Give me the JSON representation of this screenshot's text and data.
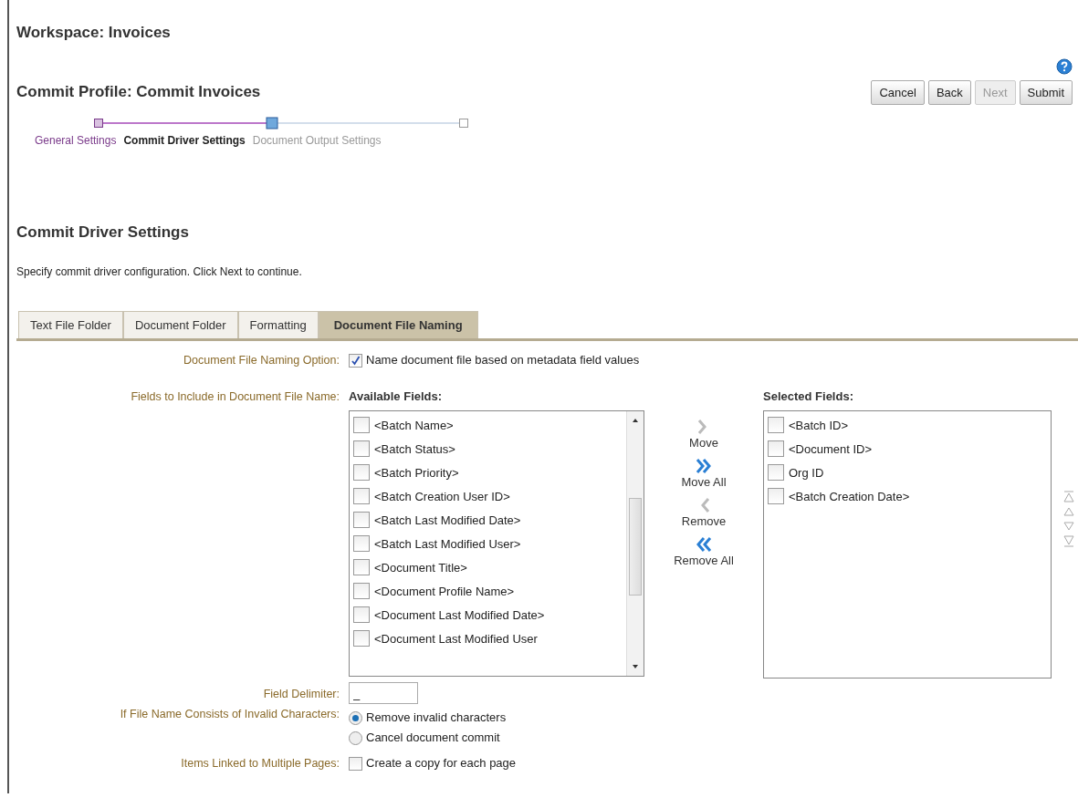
{
  "workspace_title": "Workspace: Invoices",
  "profile_title": "Commit Profile: Commit Invoices",
  "buttons": [
    {
      "label": "Cancel",
      "disabled": false
    },
    {
      "label": "Back",
      "disabled": false
    },
    {
      "label": "Next",
      "disabled": true
    },
    {
      "label": "Submit",
      "disabled": false
    }
  ],
  "train": [
    {
      "label": "General Settings",
      "visited": true,
      "selected": false
    },
    {
      "label": "Commit Driver Settings",
      "visited": true,
      "selected": true
    },
    {
      "label": "Document Output Settings",
      "visited": false,
      "selected": false
    }
  ],
  "section_title": "Commit Driver Settings",
  "description": "Specify commit driver configuration. Click Next to continue.",
  "tabs": [
    {
      "label": "Text File Folder",
      "selected": false
    },
    {
      "label": "Document Folder",
      "selected": false
    },
    {
      "label": "Formatting",
      "selected": false
    },
    {
      "label": "Document File Naming",
      "selected": true
    }
  ],
  "naming_option": {
    "label": "Document File Naming Option:",
    "text": "Name document file based on metadata field values",
    "checked": true
  },
  "fields_label": "Fields to Include in Document File Name:",
  "available": {
    "title": "Available Fields:",
    "items": [
      {
        "text": "<Batch Name>",
        "checked": false
      },
      {
        "text": "<Batch Status>",
        "checked": false
      },
      {
        "text": "<Batch Priority>",
        "checked": false
      },
      {
        "text": "<Batch Creation User ID>",
        "checked": false
      },
      {
        "text": "<Batch Last Modified Date>",
        "checked": false
      },
      {
        "text": "<Batch Last Modified User>",
        "checked": false
      },
      {
        "text": "<Document Title>",
        "checked": false
      },
      {
        "text": "<Document Profile Name>",
        "checked": false
      },
      {
        "text": "<Document Last Modified Date>",
        "checked": false
      },
      {
        "text": "<Document Last Modified User",
        "checked": false
      }
    ]
  },
  "shuttle": [
    {
      "label": "Move",
      "kind": "move",
      "disabled": true
    },
    {
      "label": "Move All",
      "kind": "move-all",
      "disabled": false
    },
    {
      "label": "Remove",
      "kind": "remove",
      "disabled": true
    },
    {
      "label": "Remove All",
      "kind": "remove-all",
      "disabled": false
    }
  ],
  "selected": {
    "title": "Selected Fields:",
    "items": [
      {
        "text": "<Batch ID>",
        "checked": false
      },
      {
        "text": "<Document ID>",
        "checked": false
      },
      {
        "text": "Org ID",
        "checked": false
      },
      {
        "text": "<Batch Creation Date>",
        "checked": false
      }
    ]
  },
  "delimiter": {
    "label": "Field Delimiter:",
    "value": "_"
  },
  "invalid": {
    "label": "If File Name Consists of Invalid Characters:",
    "options": [
      {
        "label": "Remove invalid characters",
        "selected": true
      },
      {
        "label": "Cancel document commit",
        "selected": false
      }
    ]
  },
  "linked": {
    "label": "Items Linked to Multiple Pages:",
    "text": "Create a copy for each page",
    "checked": false
  }
}
